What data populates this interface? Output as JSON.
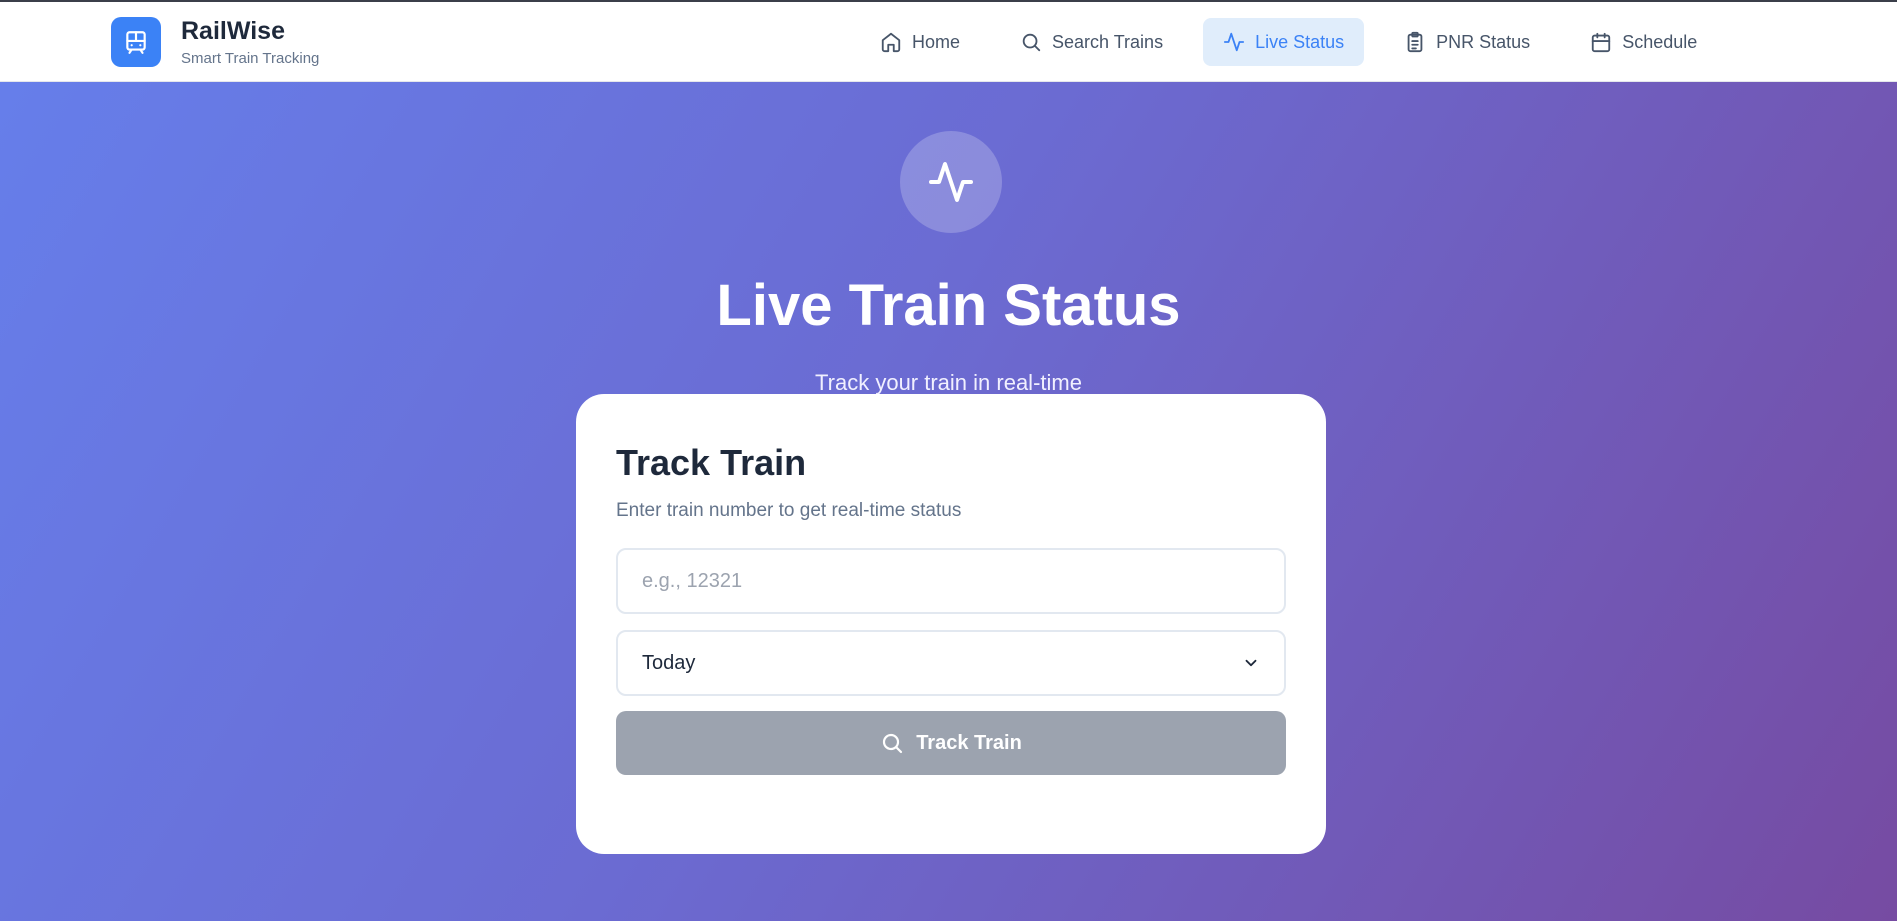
{
  "brand": {
    "name": "RailWise",
    "tagline": "Smart Train Tracking",
    "icon": "train-icon"
  },
  "nav": {
    "items": [
      {
        "label": "Home",
        "icon": "home-icon",
        "active": false
      },
      {
        "label": "Search Trains",
        "icon": "search-icon",
        "active": false
      },
      {
        "label": "Live Status",
        "icon": "activity-icon",
        "active": true
      },
      {
        "label": "PNR Status",
        "icon": "clipboard-icon",
        "active": false
      },
      {
        "label": "Schedule",
        "icon": "calendar-icon",
        "active": false
      }
    ]
  },
  "hero": {
    "icon": "activity-icon",
    "title": "Live Train Status",
    "subtitle": "Track your train in real-time"
  },
  "card": {
    "title": "Track Train",
    "subtitle": "Enter train number to get real-time status",
    "train_input": {
      "placeholder": "e.g., 12321",
      "value": ""
    },
    "date_select": {
      "value": "Today"
    },
    "button_label": "Track Train"
  },
  "colors": {
    "accent": "#3b82f6",
    "gradient_start": "#667eea",
    "gradient_end": "#764ba2",
    "button_disabled": "#9ca3af"
  }
}
